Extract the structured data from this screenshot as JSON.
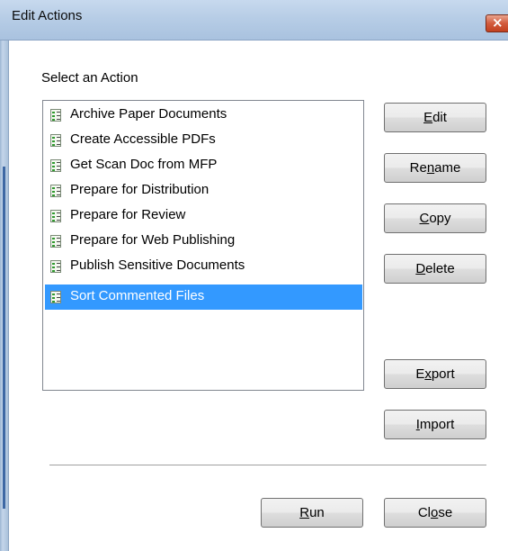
{
  "window": {
    "title": "Edit Actions",
    "close_glyph": "×"
  },
  "list": {
    "label": "Select an Action",
    "items": [
      {
        "label": "Archive Paper Documents",
        "selected": false
      },
      {
        "label": "Create Accessible PDFs",
        "selected": false
      },
      {
        "label": "Get Scan Doc from MFP",
        "selected": false
      },
      {
        "label": "Prepare for Distribution",
        "selected": false
      },
      {
        "label": "Prepare for Review",
        "selected": false
      },
      {
        "label": "Prepare for Web Publishing",
        "selected": false
      },
      {
        "label": "Publish Sensitive Documents",
        "selected": false
      },
      {
        "label": "Sort Commented Files",
        "selected": true
      }
    ],
    "item_icon": "action-checklist-icon",
    "selection_color": "#3399ff"
  },
  "buttons": {
    "edit": {
      "pre": "",
      "mnemonic": "E",
      "post": "dit"
    },
    "rename": {
      "pre": "Re",
      "mnemonic": "n",
      "post": "ame"
    },
    "copy": {
      "pre": "",
      "mnemonic": "C",
      "post": "opy"
    },
    "delete": {
      "pre": "",
      "mnemonic": "D",
      "post": "elete"
    },
    "export": {
      "pre": "E",
      "mnemonic": "x",
      "post": "port"
    },
    "import": {
      "pre": "",
      "mnemonic": "I",
      "post": "mport"
    },
    "run": {
      "pre": "",
      "mnemonic": "R",
      "post": "un"
    },
    "close": {
      "pre": "Cl",
      "mnemonic": "o",
      "post": "se"
    }
  }
}
